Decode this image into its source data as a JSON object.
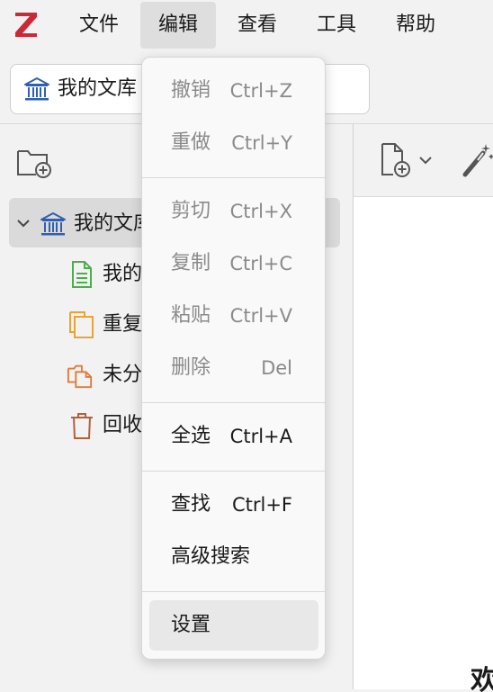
{
  "menubar": {
    "logo_icon": "zotero-z-logo",
    "items": [
      {
        "label": "文件"
      },
      {
        "label": "编辑"
      },
      {
        "label": "查看"
      },
      {
        "label": "工具"
      },
      {
        "label": "帮助"
      }
    ],
    "active_index": 1
  },
  "tab": {
    "icon": "library-icon",
    "label": "我的文库"
  },
  "left_pane": {
    "new_collection_icon": "new-collection-icon",
    "tree": [
      {
        "label": "我的文库",
        "icon": "library-icon",
        "expanded": true,
        "selected": true
      },
      {
        "label": "我的出版物",
        "icon": "publication-icon"
      },
      {
        "label": "重复条目",
        "icon": "duplicate-icon"
      },
      {
        "label": "未分类条目",
        "icon": "unfiled-icon"
      },
      {
        "label": "回收站",
        "icon": "trash-icon"
      }
    ]
  },
  "right_pane": {
    "toolbar": {
      "new_item_icon": "new-item-icon",
      "dropdown_icon": "chevron-down-icon",
      "wand_icon": "magic-wand-icon"
    },
    "heading_fragment": "欢"
  },
  "edit_menu": {
    "items": [
      {
        "label": "撤销",
        "shortcut": "Ctrl+Z",
        "enabled": false
      },
      {
        "label": "重做",
        "shortcut": "Ctrl+Y",
        "enabled": false
      },
      {
        "label": "剪切",
        "shortcut": "Ctrl+X",
        "enabled": false
      },
      {
        "label": "复制",
        "shortcut": "Ctrl+C",
        "enabled": false
      },
      {
        "label": "粘贴",
        "shortcut": "Ctrl+V",
        "enabled": false
      },
      {
        "label": "删除",
        "shortcut": "Del",
        "enabled": false
      },
      {
        "label": "全选",
        "shortcut": "Ctrl+A",
        "enabled": true
      },
      {
        "label": "查找",
        "shortcut": "Ctrl+F",
        "enabled": true
      },
      {
        "label": "高级搜索",
        "shortcut": "",
        "enabled": true
      },
      {
        "label": "设置",
        "shortcut": "",
        "enabled": true,
        "hovered": true
      }
    ]
  },
  "colors": {
    "logo_red": "#cc2936",
    "library_blue": "#2f5fb3",
    "publication_green": "#4cae4c",
    "duplicate_orange": "#e8a33a",
    "unfiled_orange": "#e07b39",
    "trash_brown": "#b5603a"
  }
}
